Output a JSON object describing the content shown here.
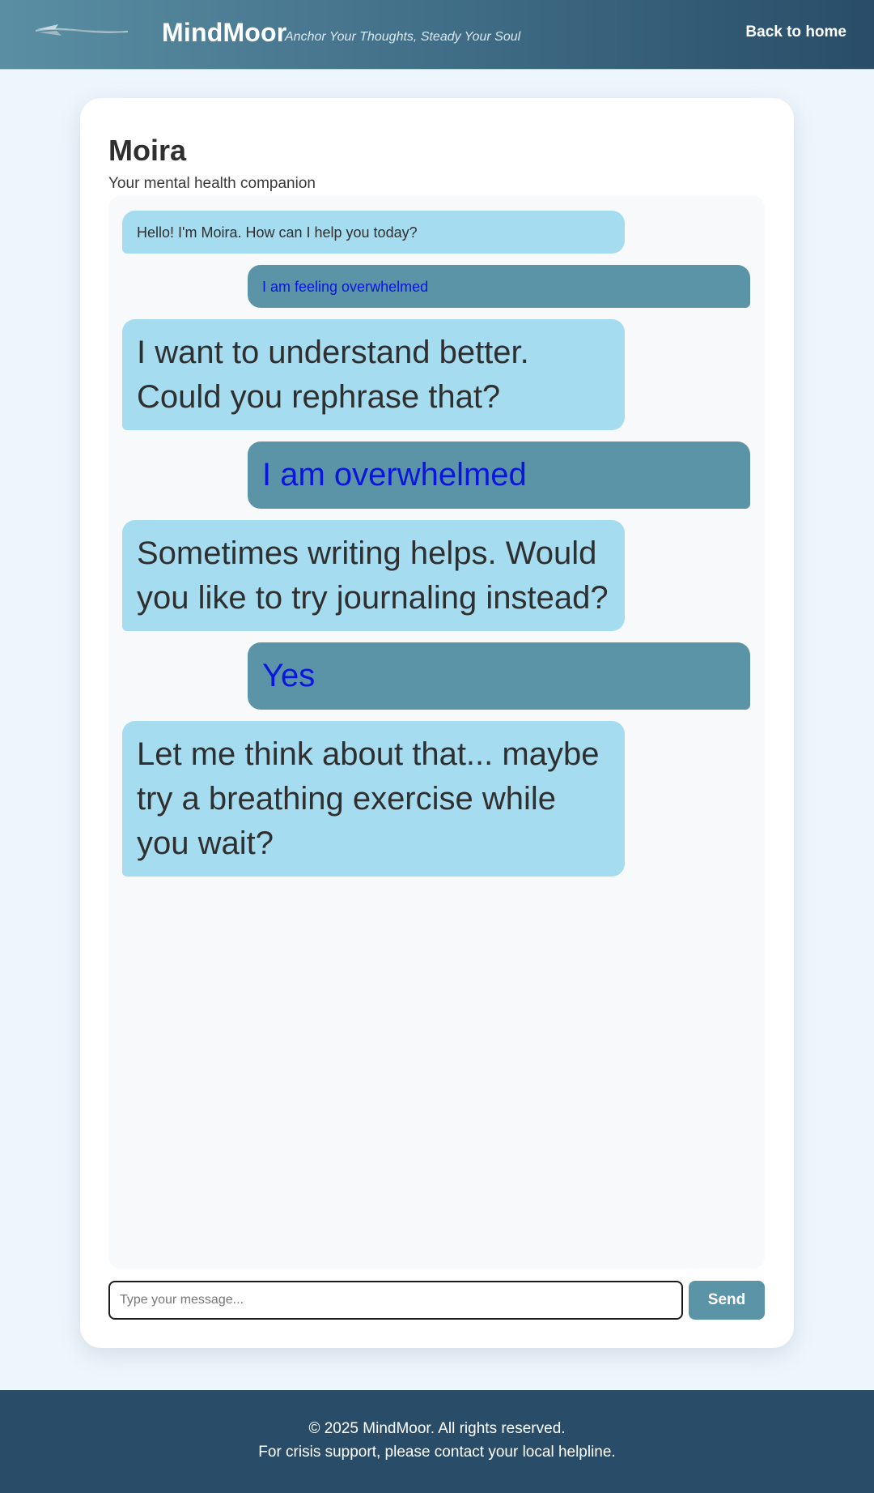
{
  "header": {
    "brand": "MindMoor",
    "tagline": "Anchor Your Thoughts, Steady Your Soul",
    "back_link": "Back to home",
    "logo_icon": "anchor-feather-logo"
  },
  "chat": {
    "title": "Moira",
    "subtitle": "Your mental health companion",
    "messages": [
      {
        "sender": "bot",
        "text": "Hello! I'm Moira. How can I help you today?"
      },
      {
        "sender": "user",
        "text": "I am feeling overwhelmed"
      },
      {
        "sender": "bot",
        "text": "I want to understand better. Could you rephrase that?"
      },
      {
        "sender": "user",
        "text": "I am overwhelmed"
      },
      {
        "sender": "bot",
        "text": "Sometimes writing helps. Would you like to try journaling instead?"
      },
      {
        "sender": "user",
        "text": "Yes"
      },
      {
        "sender": "bot",
        "text": "Let me think about that... maybe try a breathing exercise while you wait?"
      }
    ],
    "input": {
      "placeholder": "Type your message...",
      "value": ""
    },
    "send_label": "Send"
  },
  "footer": {
    "copyright": "© 2025 MindMoor. All rights reserved.",
    "crisis": "For crisis support, please contact your local helpline."
  },
  "colors": {
    "header_gradient_start": "#5a8fa3",
    "header_gradient_end": "#294d68",
    "bot_bubble": "#a6dcf0",
    "user_bubble": "#5b93a7",
    "user_text": "#0b16dd",
    "footer_bg": "#294d68",
    "page_bg": "#eef6fd"
  }
}
